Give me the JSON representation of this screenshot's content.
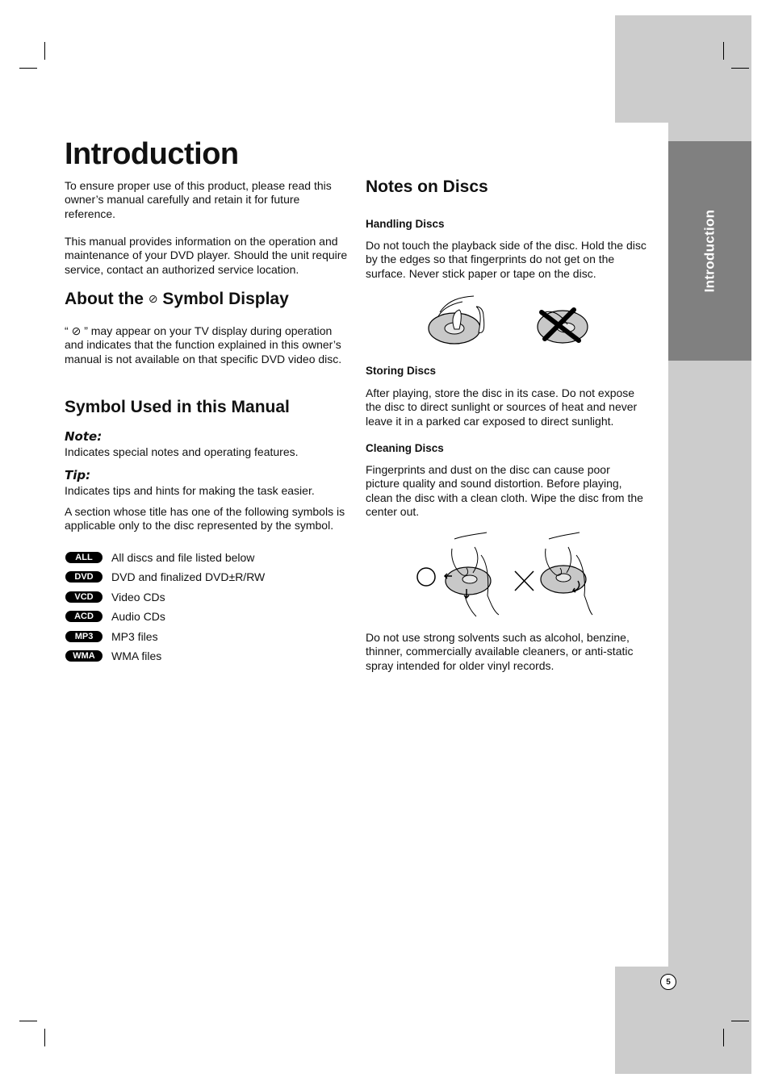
{
  "page": {
    "title": "Introduction",
    "side_tab": "Introduction",
    "page_number": "5",
    "colors": {
      "sidebar_light": "#cccccc",
      "sidebar_dark": "#808080",
      "text": "#111111",
      "badge": "#000000"
    }
  },
  "intro": {
    "para1": "To ensure proper use of this product, please read this owner’s manual carefully and retain it for future reference.",
    "para2": "This manual provides information on the operation and maintenance of your DVD player. Should the unit require service, contact an authorized service location."
  },
  "about_symbol": {
    "heading_before": "About the",
    "symbol": "⊘",
    "heading_after": "Symbol Display",
    "body_open": "“",
    "body_close": "” may appear on your TV display during operation and indicates that the function explained in this owner’s manual is not available on that specific DVD video disc."
  },
  "symbols_used": {
    "heading": "Symbol Used in this Manual",
    "note_label": "Note:",
    "note_text": "Indicates special notes and operating features.",
    "tip_label": "Tip:",
    "tip_text": "Indicates tips and hints for making the task easier.",
    "section_text": "A section whose title has one of the following symbols is applicable only to the disc represented by the symbol.",
    "badges": [
      {
        "badge": "ALL",
        "label": "All discs and file listed below"
      },
      {
        "badge": "DVD",
        "label": "DVD and finalized DVD±R/RW"
      },
      {
        "badge": "VCD",
        "label": "Video CDs"
      },
      {
        "badge": "ACD",
        "label": "Audio CDs"
      },
      {
        "badge": "MP3",
        "label": "MP3 files"
      },
      {
        "badge": "WMA",
        "label": "WMA files"
      }
    ]
  },
  "notes_on_discs": {
    "heading": "Notes on Discs",
    "handling": {
      "heading": "Handling Discs",
      "text": "Do not touch the playback side of the disc. Hold the disc by the edges so that fingerprints do not get on the surface. Never stick paper or tape on the disc."
    },
    "storing": {
      "heading": "Storing Discs",
      "text": "After playing, store the disc in its case. Do not expose the disc to direct sunlight or sources of heat and never leave it in a parked car exposed to direct sunlight."
    },
    "cleaning": {
      "heading": "Cleaning Discs",
      "text": "Fingerprints and dust on the disc can cause poor picture quality and sound distortion. Before playing, clean the disc with a clean cloth. Wipe the disc from the center out."
    },
    "solvents_text": "Do not use strong solvents such as alcohol, benzine, thinner, commercially available cleaners, or anti-static spray intended for older vinyl records."
  }
}
